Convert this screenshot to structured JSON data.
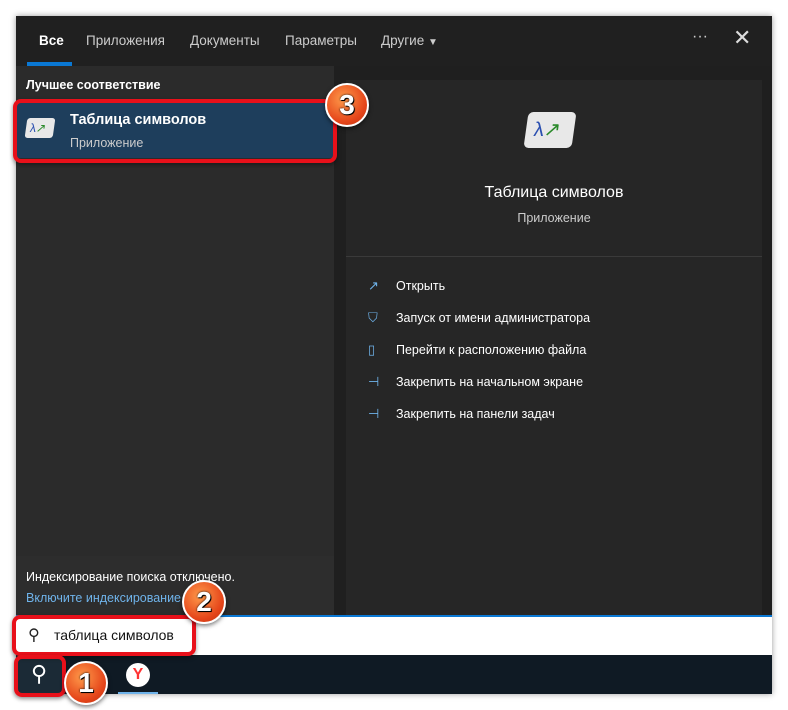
{
  "tabs": [
    "Все",
    "Приложения",
    "Документы",
    "Параметры",
    "Другие"
  ],
  "more_icon": "ellipsis-icon",
  "close_icon": "close-icon",
  "best_match": {
    "section": "Лучшее соответствие",
    "title": "Таблица символов",
    "subtitle": "Приложение"
  },
  "indexing": {
    "text": "Индексирование поиска отключено.",
    "link": "Включите индексирование"
  },
  "details": {
    "title": "Таблица символов",
    "subtitle": "Приложение",
    "actions": [
      {
        "icon": "open-icon",
        "label": "Открыть"
      },
      {
        "icon": "admin-shield-icon",
        "label": "Запуск от имени администратора"
      },
      {
        "icon": "folder-icon",
        "label": "Перейти к расположению файла"
      },
      {
        "icon": "pin-icon",
        "label": "Закрепить на начальном экране"
      },
      {
        "icon": "pin-icon",
        "label": "Закрепить на панели задач"
      }
    ]
  },
  "search": {
    "query": "таблица символов"
  },
  "badges": [
    "1",
    "2",
    "3"
  ],
  "colors": {
    "accent": "#0a78d4",
    "highlight": "#e8101a",
    "selected": "#1e3e5c"
  }
}
